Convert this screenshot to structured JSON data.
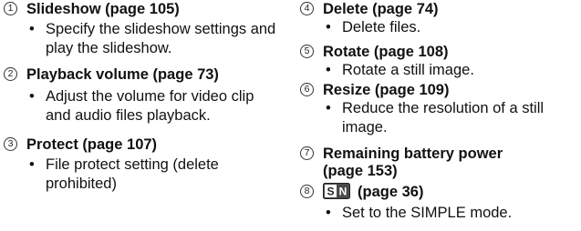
{
  "left_column": [
    {
      "num": "1",
      "title": "Slideshow (page 105)",
      "desc": "Specify the slideshow settings and play the slideshow."
    },
    {
      "num": "2",
      "title": "Playback volume (page 73)",
      "desc": "Adjust the volume for video clip and audio files playback."
    },
    {
      "num": "3",
      "title": "Protect (page 107)",
      "desc": "File protect setting (delete prohibited)"
    }
  ],
  "right_column": [
    {
      "num": "4",
      "title": "Delete (page 74)",
      "desc": "Delete files."
    },
    {
      "num": "5",
      "title": "Rotate (page 108)",
      "desc": "Rotate a still image."
    },
    {
      "num": "6",
      "title": "Resize (page 109)",
      "desc": "Reduce the resolution of a still image."
    },
    {
      "num": "7",
      "title": "Remaining battery power (page 153)",
      "desc": ""
    },
    {
      "num": "8",
      "icon": "simple-mode-icon",
      "icon_text": "SN",
      "title": "(page 36)",
      "desc": "Set to the SIMPLE mode."
    }
  ]
}
